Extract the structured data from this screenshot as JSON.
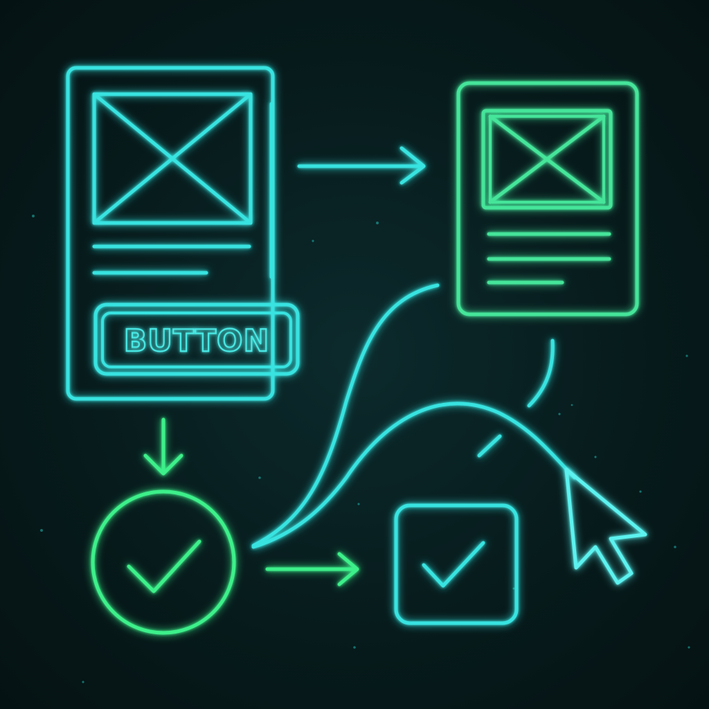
{
  "wireframe_left": {
    "button_label": "BUTTON"
  },
  "colors": {
    "background": "#071a1b",
    "cyan": "#37e3e0",
    "green": "#3df08a"
  },
  "icons": {
    "left_card_image": "image-placeholder-icon",
    "right_card_image": "image-placeholder-icon",
    "circle_check": "check-circle-icon",
    "square_check": "checkbox-checked-icon",
    "pointer": "cursor-arrow-icon"
  }
}
